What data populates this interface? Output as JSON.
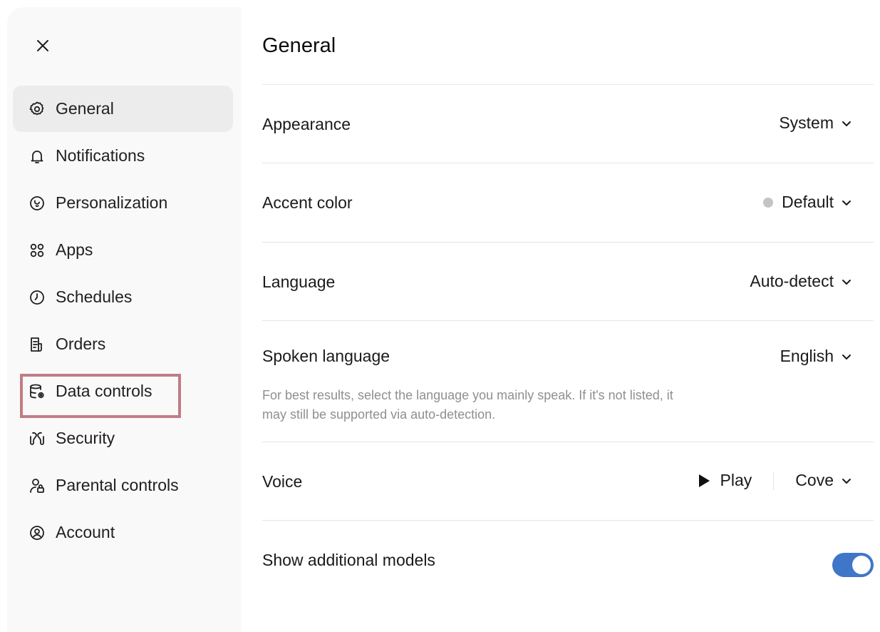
{
  "sidebar": {
    "items": [
      {
        "label": "General",
        "icon": "gear-icon",
        "active": true
      },
      {
        "label": "Notifications",
        "icon": "bell-icon"
      },
      {
        "label": "Personalization",
        "icon": "personalization-icon"
      },
      {
        "label": "Apps",
        "icon": "apps-grid-icon"
      },
      {
        "label": "Schedules",
        "icon": "clock-icon"
      },
      {
        "label": "Orders",
        "icon": "receipt-icon"
      },
      {
        "label": "Data controls",
        "icon": "database-settings-icon"
      },
      {
        "label": "Security",
        "icon": "security-icon"
      },
      {
        "label": "Parental controls",
        "icon": "parental-lock-icon"
      },
      {
        "label": "Account",
        "icon": "account-icon"
      }
    ]
  },
  "main": {
    "title": "General",
    "appearance": {
      "label": "Appearance",
      "value": "System"
    },
    "accent": {
      "label": "Accent color",
      "value": "Default",
      "dot_color": "#c4c4c4"
    },
    "language": {
      "label": "Language",
      "value": "Auto-detect"
    },
    "spoken": {
      "label": "Spoken language",
      "value": "English",
      "help": "For best results, select the language you mainly speak. If it's not listed, it may still be supported via auto-detection."
    },
    "voice": {
      "label": "Voice",
      "play_label": "Play",
      "value": "Cove"
    },
    "additional_models": {
      "label": "Show additional models",
      "enabled": true
    }
  },
  "colors": {
    "toggle_on": "#3f76c7",
    "highlight_border": "#c07d84",
    "sidebar_bg": "#f9f9f9",
    "active_item_bg": "#ececec"
  }
}
